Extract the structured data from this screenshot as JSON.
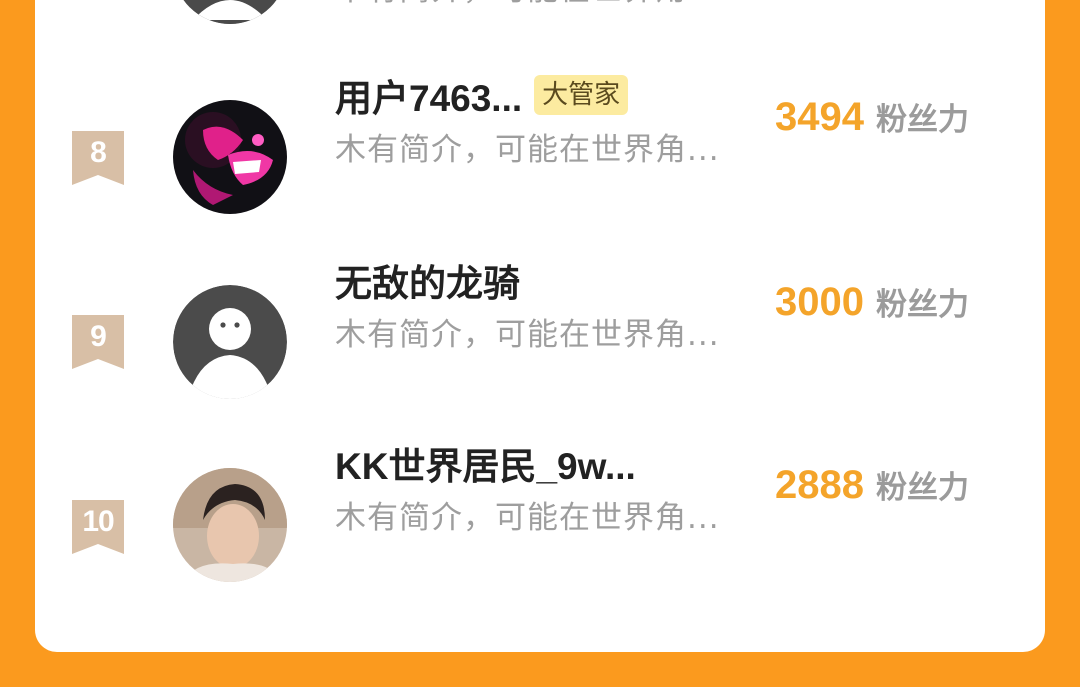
{
  "colors": {
    "background": "#FB9A1E",
    "card": "#FFFFFF",
    "fans_number": "#F4A42A",
    "rank_ribbon": "#D8BFA6",
    "badge_bg": "#FCEBA0"
  },
  "partial_row": {
    "bio": "木有简介，可能在世界角..."
  },
  "rows": [
    {
      "rank": "8",
      "name": "用户7463...",
      "badge": "大管家",
      "bio": "木有简介，可能在世界角...",
      "fans": "3494",
      "fans_label": "粉丝力",
      "avatar_icon": "dark-anime-avatar"
    },
    {
      "rank": "9",
      "name": "无敌的龙骑",
      "bio": "木有简介，可能在世界角...",
      "fans": "3000",
      "fans_label": "粉丝力",
      "avatar_icon": "default-user-avatar"
    },
    {
      "rank": "10",
      "name": "KK世界居民_9w...",
      "bio": "木有简介，可能在世界角...",
      "fans": "2888",
      "fans_label": "粉丝力",
      "avatar_icon": "photo-avatar"
    }
  ]
}
